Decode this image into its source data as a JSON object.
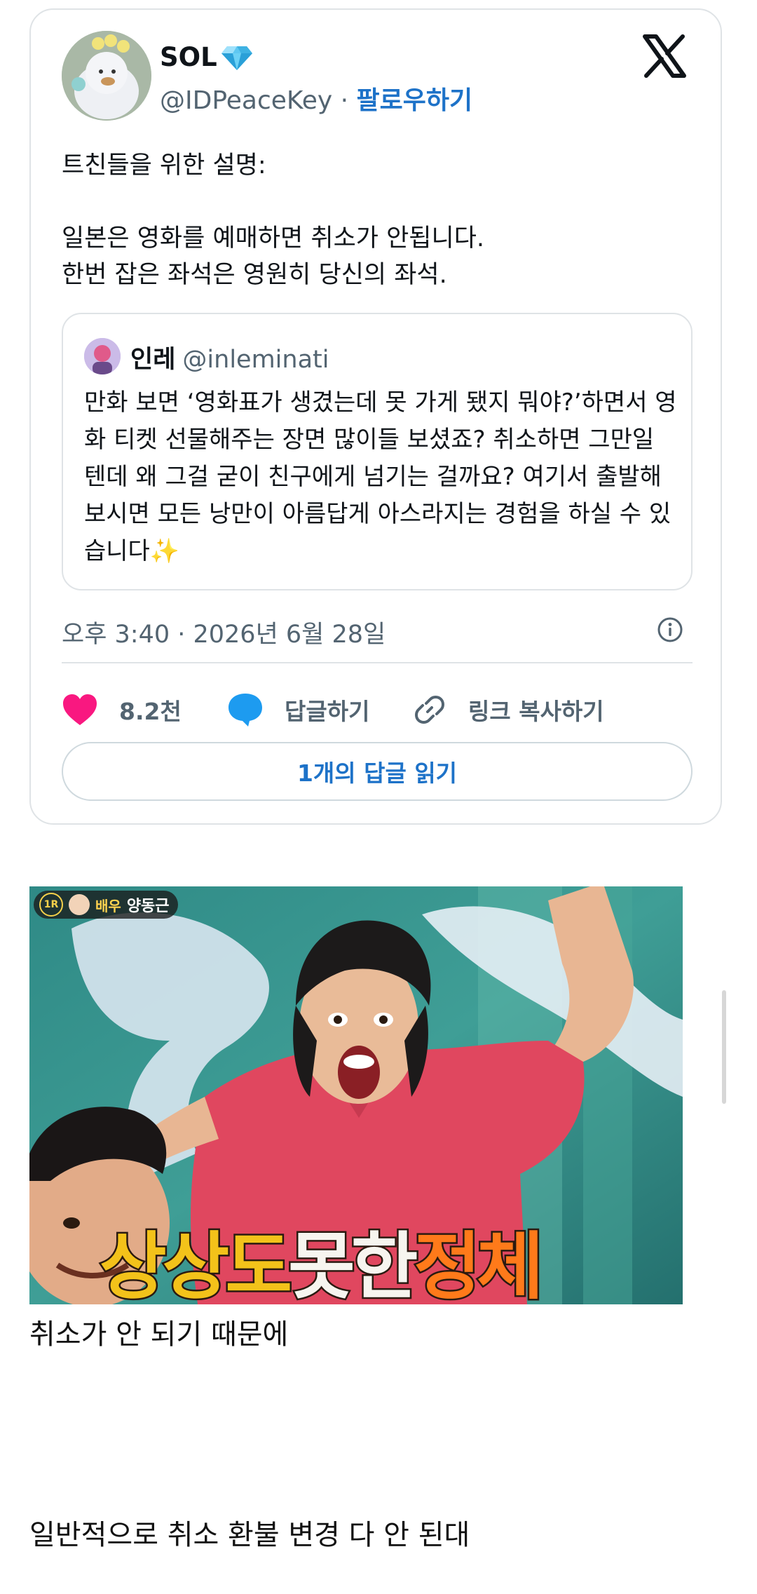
{
  "tweet": {
    "display_name": "SOL",
    "handle": "@IDPeaceKey",
    "separator": " · ",
    "follow_label": "팔로우하기",
    "text_lines": [
      "트친들을 위한 설명:",
      "일본은 영화를 예매하면 취소가 안됩니다.",
      "한번 잡은 좌석은 영원히 당신의 좌석."
    ],
    "quote": {
      "name": "인레",
      "handle": "@inleminati",
      "text": "만화 보면 ‘영화표가 생겼는데 못 가게 됐지 뭐야?’하면서 영화 티켓 선물해주는 장면 많이들 보셨죠? 취소하면 그만일 텐데 왜 그걸 굳이 친구에게 넘기는 걸까요? 여기서 출발해 보시면 모든 낭만이 아름답게 아스라지는 경험을 하실 수 있습니다✨"
    },
    "timestamp": "오후 3:40 · 2026년 6월 28일",
    "actions": {
      "likes": "8.2천",
      "reply": "답글하기",
      "copy_link": "링크 복사하기"
    },
    "read_replies": "1개의 답글 읽기"
  },
  "meme": {
    "badge_round": "1R",
    "badge_role": "배우",
    "badge_name": "양동근",
    "caption_part1": "상상도",
    "caption_part2": "못한",
    "caption_part3": "정체"
  },
  "body": {
    "line1": "취소가 안 되기 때문에",
    "line2": "일반적으로 취소 환불 변경 다 안 된대"
  },
  "colors": {
    "link_blue": "#1d72c8",
    "like_pink": "#f91880",
    "reply_blue": "#1d9bf0",
    "secondary_text": "#536471"
  },
  "icons": [
    "verified-icon",
    "x-logo-icon",
    "info-icon",
    "heart-icon",
    "reply-bubble-icon",
    "link-icon"
  ]
}
